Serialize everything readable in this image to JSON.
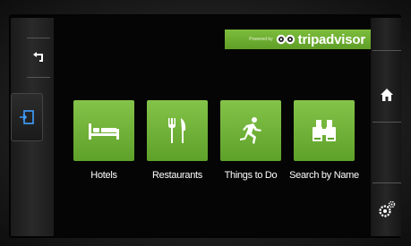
{
  "brand": {
    "powered_by": "Powered by",
    "name": "tripadvisor",
    "accent_color": "#6aab31"
  },
  "nav": {
    "back_icon": "back-arrow-icon",
    "source_icon": "input-source-icon",
    "home_icon": "home-icon",
    "settings_icon": "settings-gear-icon"
  },
  "tiles": [
    {
      "label": "Hotels",
      "icon": "bed-icon"
    },
    {
      "label": "Restaurants",
      "icon": "fork-knife-icon"
    },
    {
      "label": "Things to Do",
      "icon": "running-person-icon"
    },
    {
      "label": "Search by Name",
      "icon": "binoculars-icon"
    }
  ]
}
